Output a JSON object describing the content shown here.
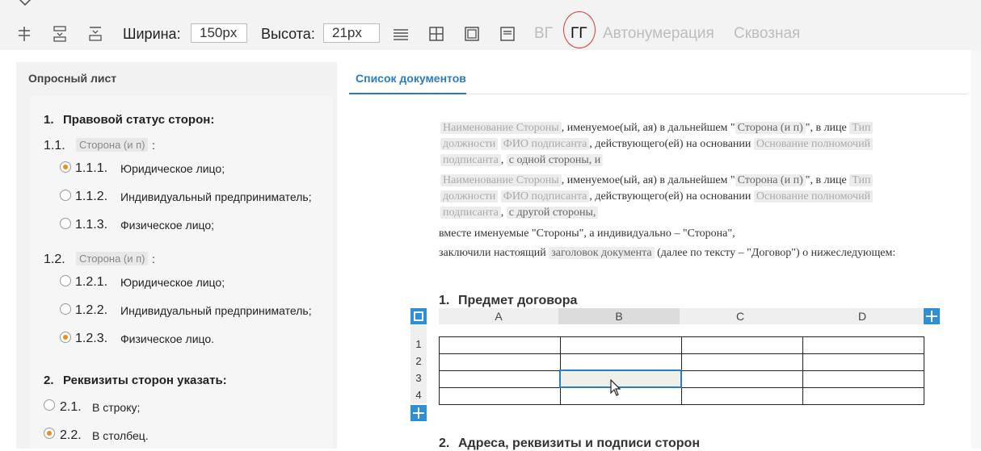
{
  "toolbar": {
    "width_label": "Ширина:",
    "width_value": "150px",
    "height_label": "Высота:",
    "height_value": "21px",
    "text_vg": "ВГ",
    "text_gg": "ГГ",
    "autonumber": "Автонумерация",
    "through": "Сквозная"
  },
  "left": {
    "tab_title": "Опросный лист",
    "q1": {
      "num": "1.",
      "title": "Правовой статус сторон:",
      "sub1": {
        "num": "1.1.",
        "field": "Сторона (и п)",
        "options": [
          {
            "num": "1.1.1.",
            "label": "Юридическое лицо;",
            "checked": true
          },
          {
            "num": "1.1.2.",
            "label": "Индивидуальный предприниматель;",
            "checked": false
          },
          {
            "num": "1.1.3.",
            "label": "Физическое лицо;",
            "checked": false
          }
        ]
      },
      "sub2": {
        "num": "1.2.",
        "field": "Сторона (и п)",
        "options": [
          {
            "num": "1.2.1.",
            "label": "Юридическое лицо;",
            "checked": false
          },
          {
            "num": "1.2.2.",
            "label": "Индивидуальный предприниматель;",
            "checked": false
          },
          {
            "num": "1.2.3.",
            "label": "Физическое лицо.",
            "checked": true
          }
        ]
      }
    },
    "q2": {
      "num": "2.",
      "title": "Реквизиты сторон указать:",
      "options": [
        {
          "num": "2.1.",
          "label": "В строку;",
          "checked": false
        },
        {
          "num": "2.2.",
          "label": "В столбец.",
          "checked": true
        }
      ]
    }
  },
  "right": {
    "tab_title": "Список документов",
    "party": {
      "name_field": "Наименование Стороны",
      "called": ", именуемое(ый, ая) в дальнейшем \"",
      "party_field": "Сторона (и п)",
      "in_person": "\", в лице",
      "position_field_1": "Тип",
      "position_field_2": "должности",
      "signer_field": "ФИО подписанта",
      "acting": ", действующего(ей) на основании",
      "authority_field_1": "Основание полномочий",
      "authority_field_2": "подписанта",
      "one_side": "с одной стороны, и",
      "other_side": "с другой стороны,"
    },
    "together_line": "вместе именуемые \"Стороны\", а индивидуально – \"Сторона\",",
    "concluded_prefix": "заключили настоящий",
    "doc_title_field": "заголовок документа",
    "concluded_suffix": "(далее по тексту – \"Договор\") о нижеследующем:",
    "section1_num": "1.",
    "section1_title": "Предмет договора",
    "section2_num": "2.",
    "section2_title": "Адреса, реквизиты и подписи сторон",
    "table": {
      "columns": [
        "A",
        "B",
        "C",
        "D"
      ],
      "rows": [
        "1",
        "2",
        "3",
        "4"
      ]
    }
  }
}
